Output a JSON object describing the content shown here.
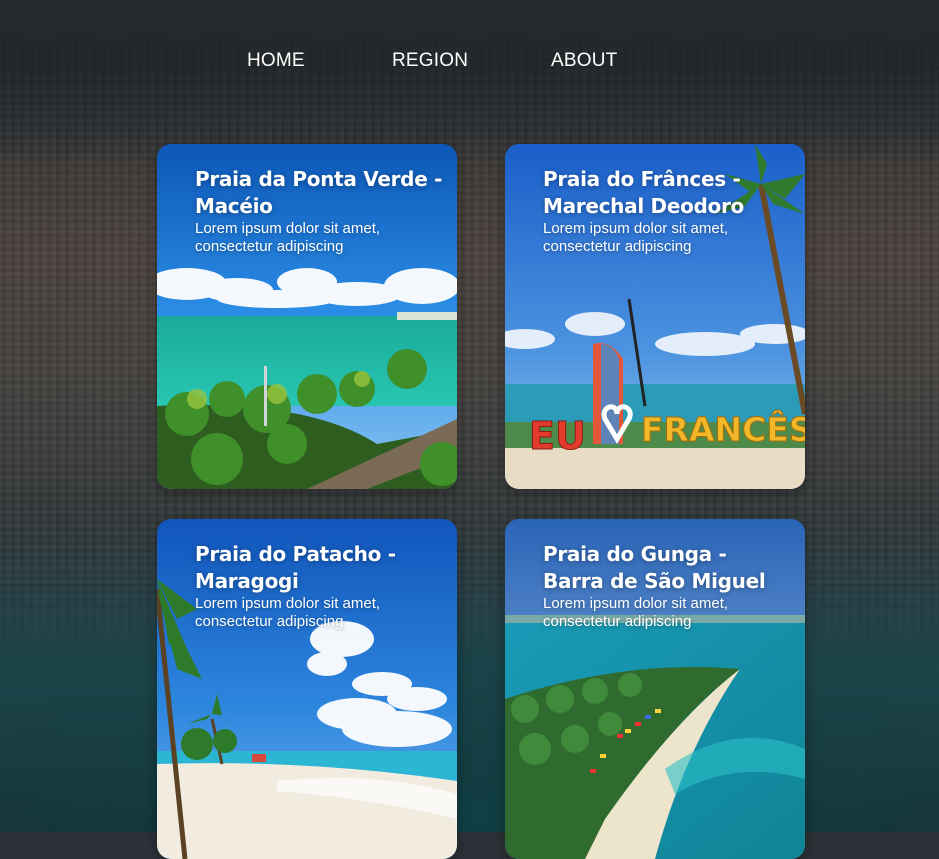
{
  "nav": {
    "home_label": "HOME",
    "region_label": "REGION",
    "about_label": "ABOUT"
  },
  "cards": [
    {
      "title": "Praia da Ponta Verde - Macéio",
      "description": "Lorem ipsum dolor sit amet, consectetur adipiscing"
    },
    {
      "title": "Praia do Frânces - Marechal Deodoro",
      "description": "Lorem ipsum dolor sit amet, consectetur adipiscing",
      "sign_text": "EU ♡ FRANCÊS"
    },
    {
      "title": "Praia do Patacho - Maragogi",
      "description": "Lorem ipsum dolor sit amet, consectetur adipiscing"
    },
    {
      "title": "Praia do Gunga - Barra de São Miguel",
      "description": "Lorem ipsum dolor sit amet, consectetur adipiscing"
    }
  ],
  "colors": {
    "sky_blue": "#1565c0",
    "sea_turquoise": "#1fbfa8",
    "text": "#ffffff"
  }
}
